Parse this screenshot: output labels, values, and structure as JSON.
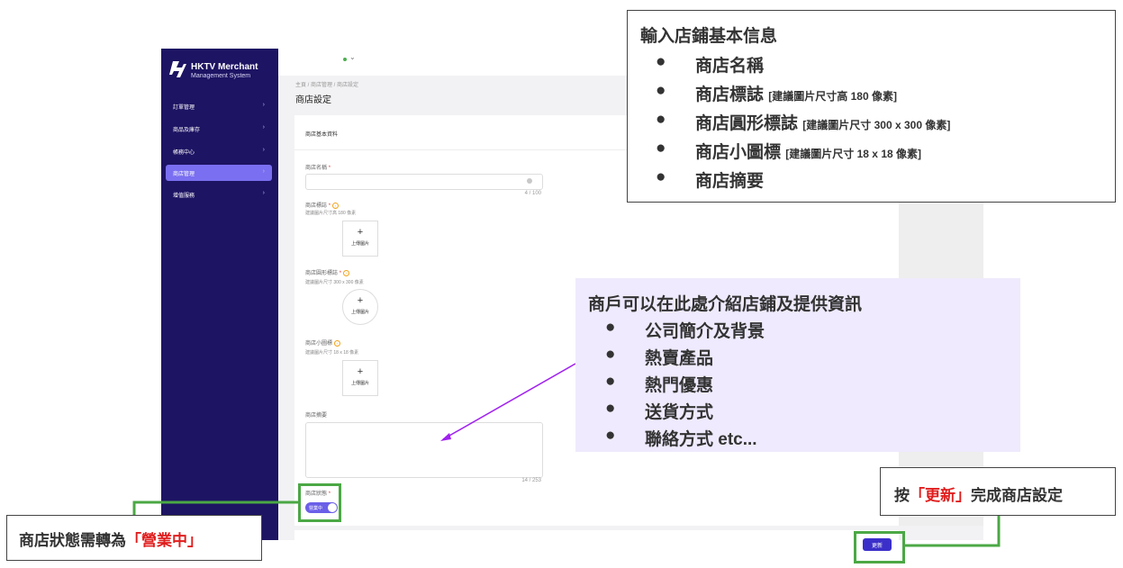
{
  "app": {
    "logo_title": "HKTV Merchant",
    "logo_subtitle": "Management System",
    "sidebar": [
      {
        "label": "訂單管理",
        "active": false
      },
      {
        "label": "商品及庫存",
        "active": false
      },
      {
        "label": "帳務中心",
        "active": false
      },
      {
        "label": "商店管理",
        "active": true
      },
      {
        "label": "增值服務",
        "active": false
      }
    ],
    "breadcrumb": "主頁 / 商店管理 / 商店設定",
    "page_title": "商店設定",
    "section_title": "商店基本資料",
    "fields": {
      "store_name_label": "商店名稱",
      "store_name_value": "",
      "store_name_counter": "4 / 100",
      "logo_label": "商店標誌",
      "logo_hint": "建議圖片尺寸高 180 像素",
      "round_logo_label": "商店圓形標誌",
      "round_logo_hint": "建議圖片尺寸 300 x 300 像素",
      "icon_label": "商店小圖標",
      "icon_hint": "建議圖片尺寸 18 x 18 像素",
      "upload_label": "上傳圖片",
      "upload_plus": "+",
      "summary_label": "商店摘要",
      "summary_value": "",
      "summary_counter": "14 / 253",
      "status_label": "商店狀態",
      "status_toggle": "營業中",
      "required_mark": "*"
    },
    "update_button": "更新",
    "colors": {
      "sidebar": "#1d1463",
      "active_item": "#7a6ff0",
      "primary_button": "#3b2fc9",
      "annotation_green": "#4ba845",
      "annotation_red": "#e01e1e"
    }
  },
  "annotations": {
    "box1_title": "輸入店鋪基本信息",
    "box1_items": [
      {
        "text": "商店名稱",
        "small": ""
      },
      {
        "text": "商店標誌",
        "small": "[建議圖片尺寸高 180 像素]"
      },
      {
        "text": "商店圓形標誌",
        "small": "[建議圖片尺寸 300 x 300 像素]"
      },
      {
        "text": "商店小圖標",
        "small": "[建議圖片尺寸 18 x 18 像素]"
      },
      {
        "text": "商店摘要",
        "small": ""
      }
    ],
    "box2_title": "商戶可以在此處介紹店鋪及提供資訊",
    "box2_items": [
      "公司簡介及背景",
      "熱賣產品",
      "熱門優惠",
      "送貨方式",
      "聯絡方式 etc..."
    ],
    "box3_prefix": "按",
    "box3_highlight": "「更新」",
    "box3_suffix": "完成商店設定",
    "box4_prefix": "商店狀態需轉為",
    "box4_highlight": "「營業中」",
    "bullet": "●"
  }
}
